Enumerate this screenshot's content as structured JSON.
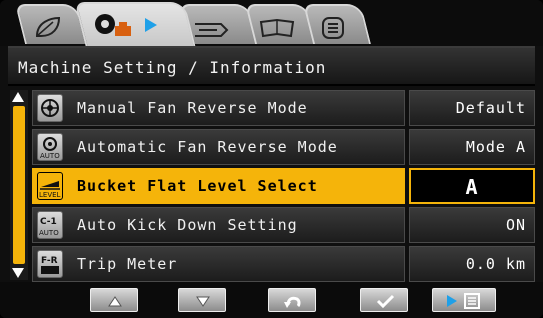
{
  "tabs": [
    {
      "icon": "leaf-icon"
    },
    {
      "icon": "machine-settings-icon",
      "active": true
    },
    {
      "icon": "road-icon"
    },
    {
      "icon": "book-icon"
    },
    {
      "icon": "menu-list-icon"
    }
  ],
  "title": "Machine Setting / Information",
  "rows": [
    {
      "label": "Manual Fan Reverse Mode",
      "value": "Default",
      "icon": "fan-icon"
    },
    {
      "label": "Automatic Fan Reverse Mode",
      "value": "Mode A",
      "icon": "auto-fan-icon"
    },
    {
      "label": "Bucket Flat Level Select",
      "value": "A",
      "icon": "bucket-level-icon",
      "icon_text": "LEVEL",
      "selected": true
    },
    {
      "label": "Auto Kick Down Setting",
      "value": "ON",
      "icon": "kick-down-icon",
      "icon_text_top": "C-1",
      "icon_text_bottom": "AUTO"
    },
    {
      "label": "Trip Meter",
      "value": "0.0 km",
      "icon": "trip-meter-icon",
      "icon_text": "F-R"
    }
  ],
  "footer": {
    "buttons": [
      "up-arrow-icon",
      "down-arrow-icon",
      "back-icon",
      "check-icon",
      "menu-icon"
    ]
  },
  "colors": {
    "accent": "#f5b40a",
    "background": "#0f0f0f"
  }
}
